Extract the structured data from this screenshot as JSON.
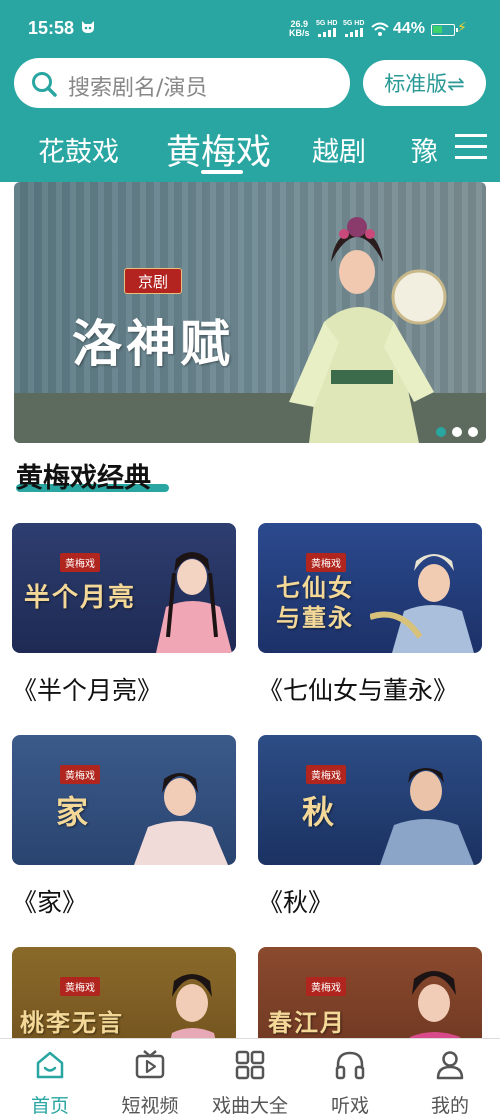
{
  "status_bar": {
    "time": "15:58",
    "net_speed_value": "26.9",
    "net_speed_unit": "KB/s",
    "signal1": "5G HD",
    "signal2": "5G HD",
    "battery": "44%"
  },
  "search": {
    "placeholder": "搜索剧名/演员"
  },
  "version_button": {
    "label": "标准版⇌"
  },
  "tabs": [
    {
      "label": "花鼓戏"
    },
    {
      "label": "黄梅戏",
      "active": true
    },
    {
      "label": "越剧"
    },
    {
      "label": "豫"
    }
  ],
  "banner": {
    "tag": "京剧",
    "title": "洛神赋",
    "page_count": 3,
    "current_page": 1
  },
  "section": {
    "title": "黄梅戏经典"
  },
  "cards": [
    {
      "name": "《半个月亮》",
      "badge": "黄梅戏",
      "thumb_title": "半个月亮"
    },
    {
      "name": "《七仙女与董永》",
      "badge": "黄梅戏",
      "thumb_title": "七仙女与董永"
    },
    {
      "name": "《家》",
      "badge": "黄梅戏",
      "thumb_title": "家"
    },
    {
      "name": "《秋》",
      "badge": "黄梅戏",
      "thumb_title": "秋"
    },
    {
      "name": "",
      "badge": "黄梅戏",
      "thumb_title": "桃李无言"
    },
    {
      "name": "",
      "badge": "黄梅戏",
      "thumb_title": "春江月"
    }
  ],
  "bottom_nav": [
    {
      "label": "首页",
      "icon": "home-icon",
      "active": true
    },
    {
      "label": "短视频",
      "icon": "video-icon"
    },
    {
      "label": "戏曲大全",
      "icon": "grid-icon"
    },
    {
      "label": "听戏",
      "icon": "headphones-icon"
    },
    {
      "label": "我的",
      "icon": "user-icon"
    }
  ],
  "colors": {
    "accent": "#2aa6a2",
    "tag_red": "#b0251d"
  }
}
